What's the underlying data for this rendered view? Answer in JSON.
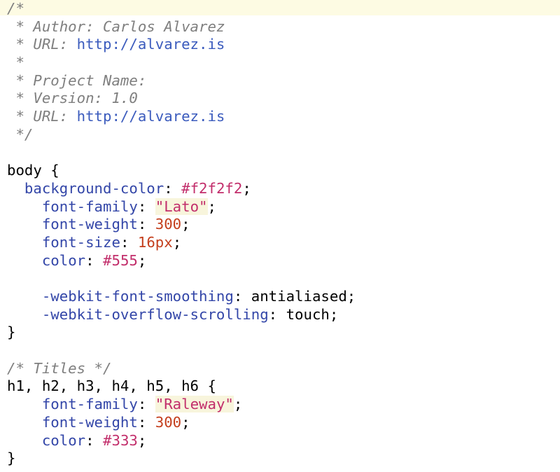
{
  "colors": {
    "comment": "#7f7f7f",
    "url": "#3b5bbd",
    "property": "#3346a8",
    "hex": "#c22e6b",
    "number": "#c43e1c",
    "string": "#c22e6b",
    "current_line": "#fdfbe3"
  },
  "code_lines": [
    [
      {
        "t": "comment",
        "v": "/*"
      }
    ],
    [
      {
        "t": "comment",
        "v": " * Author: Carlos Alvarez"
      }
    ],
    [
      {
        "t": "comment",
        "v": " * URL: "
      },
      {
        "t": "url",
        "v": "http://alvarez.is"
      }
    ],
    [
      {
        "t": "comment",
        "v": " *"
      }
    ],
    [
      {
        "t": "comment",
        "v": " * Project Name:"
      }
    ],
    [
      {
        "t": "comment",
        "v": " * Version: 1.0"
      }
    ],
    [
      {
        "t": "comment",
        "v": " * URL: "
      },
      {
        "t": "url",
        "v": "http://alvarez.is"
      }
    ],
    [
      {
        "t": "comment",
        "v": " */"
      }
    ],
    [],
    [
      {
        "t": "sel",
        "v": "body {"
      }
    ],
    [
      {
        "t": "plain",
        "v": "  "
      },
      {
        "t": "prop",
        "v": "background-color"
      },
      {
        "t": "punc",
        "v": ": "
      },
      {
        "t": "hex",
        "v": "#f2f2f2"
      },
      {
        "t": "punc",
        "v": ";"
      }
    ],
    [
      {
        "t": "plain",
        "v": "    "
      },
      {
        "t": "prop",
        "v": "font-family"
      },
      {
        "t": "punc",
        "v": ": "
      },
      {
        "t": "str",
        "v": "\"Lato\""
      },
      {
        "t": "punc",
        "v": ";"
      }
    ],
    [
      {
        "t": "plain",
        "v": "    "
      },
      {
        "t": "prop",
        "v": "font-weight"
      },
      {
        "t": "punc",
        "v": ": "
      },
      {
        "t": "num",
        "v": "300"
      },
      {
        "t": "punc",
        "v": ";"
      }
    ],
    [
      {
        "t": "plain",
        "v": "    "
      },
      {
        "t": "prop",
        "v": "font-size"
      },
      {
        "t": "punc",
        "v": ": "
      },
      {
        "t": "num",
        "v": "16px"
      },
      {
        "t": "punc",
        "v": ";"
      }
    ],
    [
      {
        "t": "plain",
        "v": "    "
      },
      {
        "t": "prop",
        "v": "color"
      },
      {
        "t": "punc",
        "v": ": "
      },
      {
        "t": "hex",
        "v": "#555"
      },
      {
        "t": "punc",
        "v": ";"
      }
    ],
    [],
    [
      {
        "t": "plain",
        "v": "    "
      },
      {
        "t": "prop",
        "v": "-webkit-font-smoothing"
      },
      {
        "t": "punc",
        "v": ": "
      },
      {
        "t": "plain",
        "v": "antialiased"
      },
      {
        "t": "punc",
        "v": ";"
      }
    ],
    [
      {
        "t": "plain",
        "v": "    "
      },
      {
        "t": "prop",
        "v": "-webkit-overflow-scrolling"
      },
      {
        "t": "punc",
        "v": ": "
      },
      {
        "t": "plain",
        "v": "touch"
      },
      {
        "t": "punc",
        "v": ";"
      }
    ],
    [
      {
        "t": "sel",
        "v": "}"
      }
    ],
    [],
    [
      {
        "t": "comment",
        "v": "/* Titles */"
      }
    ],
    [
      {
        "t": "sel",
        "v": "h1, h2, h3, h4, h5, h6 {"
      }
    ],
    [
      {
        "t": "plain",
        "v": "    "
      },
      {
        "t": "prop",
        "v": "font-family"
      },
      {
        "t": "punc",
        "v": ": "
      },
      {
        "t": "str",
        "v": "\"Raleway\""
      },
      {
        "t": "punc",
        "v": ";"
      }
    ],
    [
      {
        "t": "plain",
        "v": "    "
      },
      {
        "t": "prop",
        "v": "font-weight"
      },
      {
        "t": "punc",
        "v": ": "
      },
      {
        "t": "num",
        "v": "300"
      },
      {
        "t": "punc",
        "v": ";"
      }
    ],
    [
      {
        "t": "plain",
        "v": "    "
      },
      {
        "t": "prop",
        "v": "color"
      },
      {
        "t": "punc",
        "v": ": "
      },
      {
        "t": "hex",
        "v": "#333"
      },
      {
        "t": "punc",
        "v": ";"
      }
    ],
    [
      {
        "t": "sel",
        "v": "}"
      }
    ]
  ]
}
